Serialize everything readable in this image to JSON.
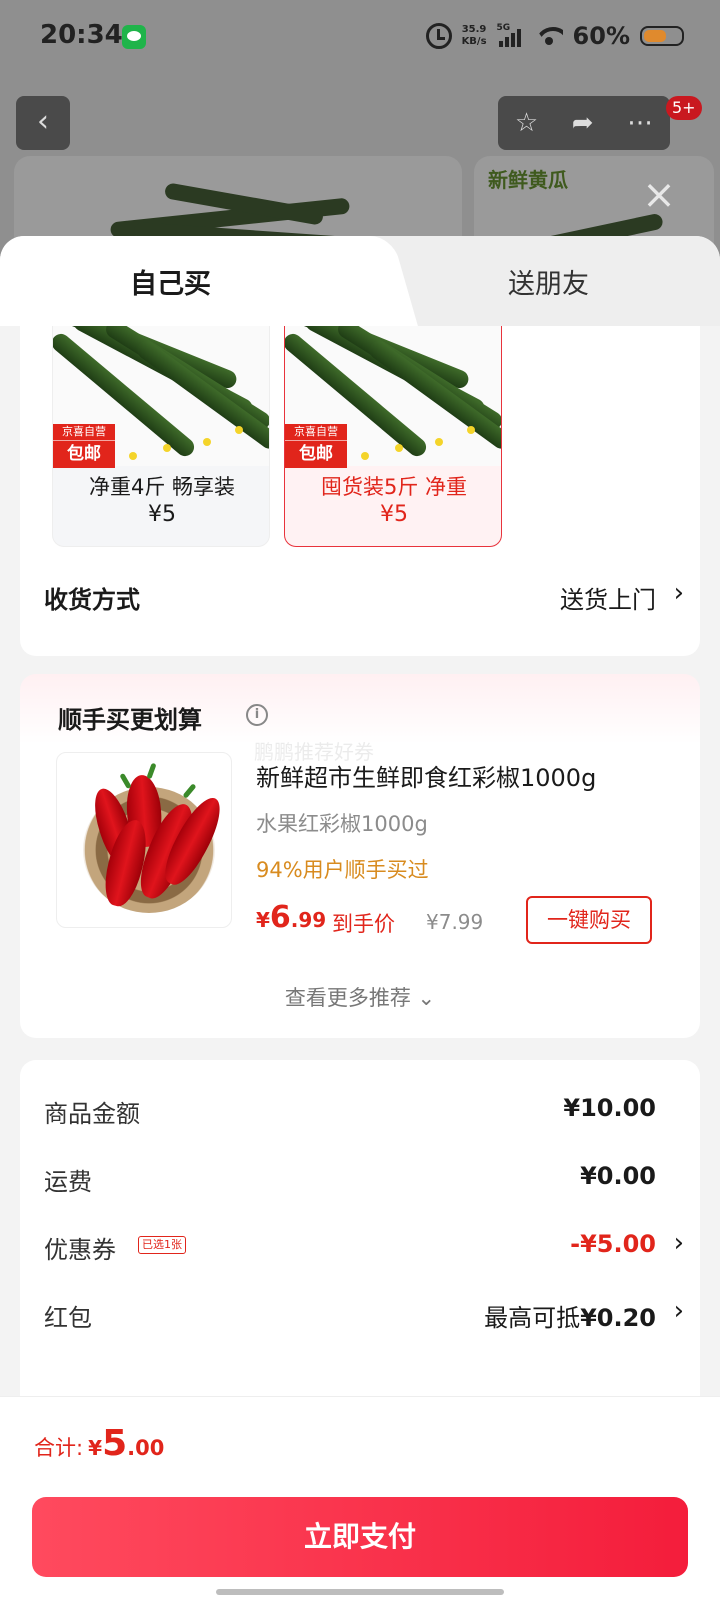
{
  "status_bar": {
    "time": "20:34",
    "net_speed_value": "35.9",
    "net_speed_unit": "KB/s",
    "network": "5G",
    "battery_pct": "60%",
    "battery_level": 0.6
  },
  "background": {
    "back_icon": "chevron-left-icon",
    "badge": "5+",
    "product_title": "新鲜黄瓜",
    "close_icon": "close-icon"
  },
  "tabs": [
    {
      "label": "自己买",
      "active": true
    },
    {
      "label": "送朋友",
      "active": false
    }
  ],
  "specs": [
    {
      "tag_top": "京喜自营",
      "tag_bottom": "包邮",
      "name": "净重4斤 畅享装",
      "price": "¥5",
      "selected": false
    },
    {
      "tag_top": "京喜自营",
      "tag_bottom": "包邮",
      "name": "囤货装5斤 净重",
      "price": "¥5",
      "selected": true
    }
  ],
  "delivery": {
    "label": "收货方式",
    "value": "送货上门",
    "chevron": "›"
  },
  "recommend": {
    "title": "顺手买更划算",
    "info_icon": "i",
    "watermark": "鹏鹏推荐好券",
    "product_name": "新鲜超市生鲜即食红彩椒1000g",
    "product_sub": "水果红彩椒1000g",
    "social_proof": "94%用户顺手买过",
    "price_currency": "¥",
    "price_int": "6",
    "price_dec": ".99",
    "price_label": "到手价",
    "original_price": "¥7.99",
    "buy_button": "一键购买",
    "more": "查看更多推荐 ⌄"
  },
  "summary": {
    "rows": [
      {
        "label": "商品金额",
        "value": "¥10.00"
      },
      {
        "label": "运费",
        "value": "¥0.00"
      },
      {
        "label": "优惠券",
        "tag": "已选1张",
        "value": "-¥5.00",
        "chevron": "›"
      },
      {
        "label": "红包",
        "value_prefix": "最高可抵",
        "value": "¥0.20",
        "chevron": "›"
      }
    ]
  },
  "bottom": {
    "total_label": "合计:",
    "total_currency": "¥",
    "total_int": "5",
    "total_dec": ".00",
    "pay_button": "立即支付"
  },
  "colors": {
    "accent": "#e1251b",
    "pay_start": "#ff4a5e",
    "pay_end": "#f41d3b",
    "orange": "#d88b1f"
  }
}
